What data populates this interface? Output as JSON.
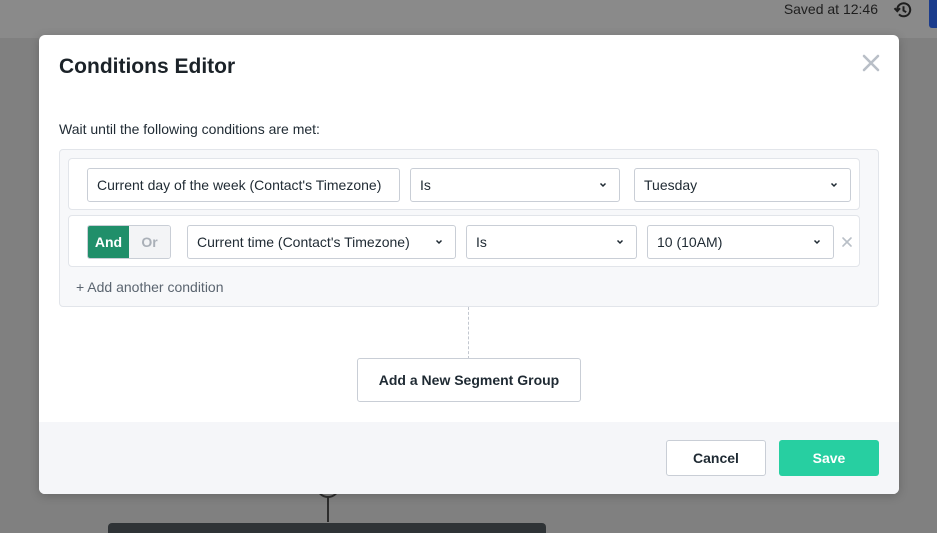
{
  "background": {
    "saved_status": "Saved at 12:46",
    "history_icon": "history-icon"
  },
  "modal": {
    "title": "Conditions Editor",
    "close_icon": "close-icon",
    "instruction": "Wait until the following conditions are met:",
    "conditions": [
      {
        "field": "Current day of the week (Contact's Timezone)",
        "operator": "Is",
        "value": "Tuesday"
      },
      {
        "logic_and": "And",
        "logic_or": "Or",
        "logic_selected": "And",
        "field": "Current time (Contact's Timezone)",
        "operator": "Is",
        "value": "10 (10AM)"
      }
    ],
    "add_condition_label": "+ Add another condition",
    "add_segment_group_label": "Add a New Segment Group",
    "cancel_label": "Cancel",
    "save_label": "Save"
  },
  "colors": {
    "and_active": "#208f6a",
    "save_button": "#27cfa1",
    "overlay": "#808080"
  }
}
